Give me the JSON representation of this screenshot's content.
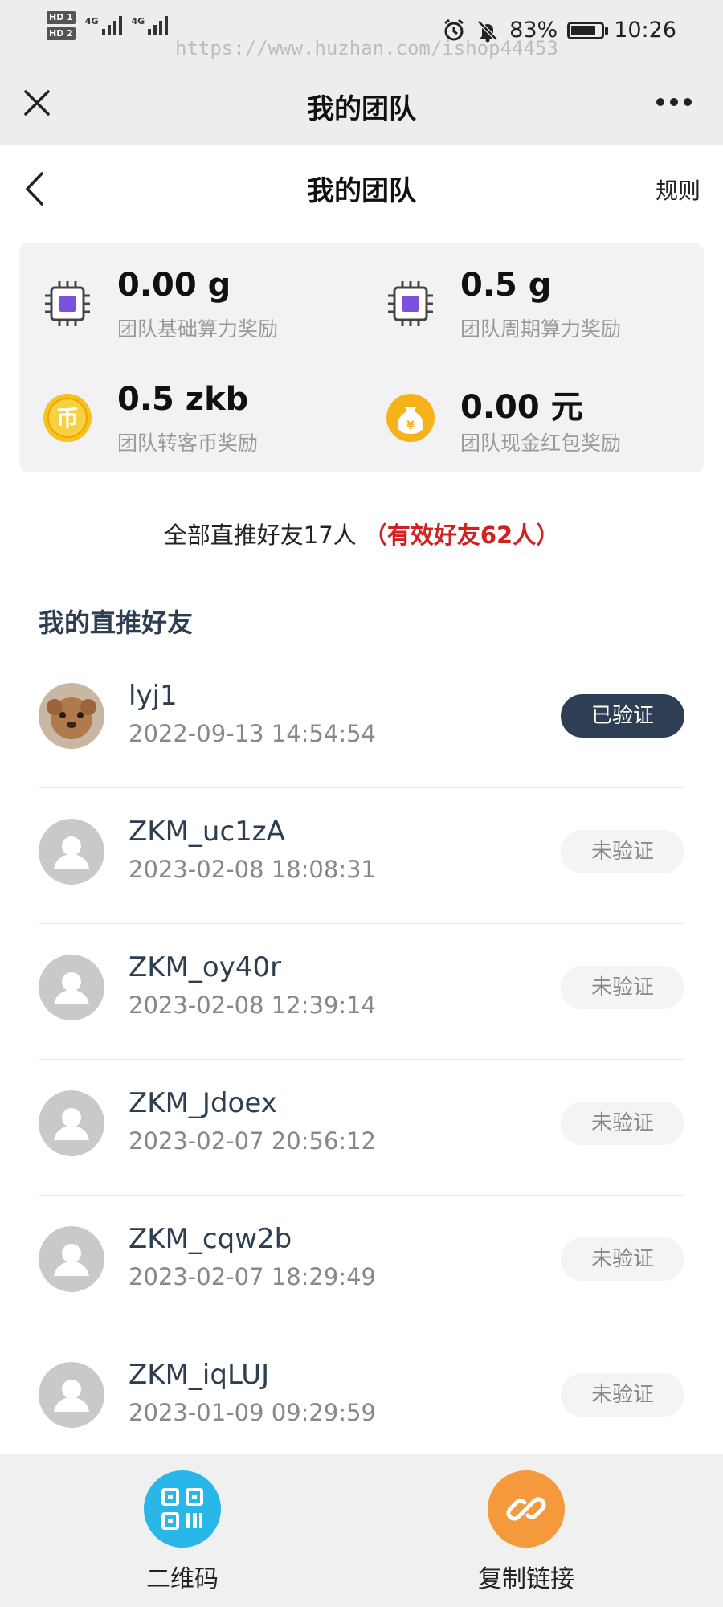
{
  "status_bar": {
    "hd1": "HD 1",
    "hd2": "HD 2",
    "net1": "4G",
    "net2": "4G",
    "battery": "83%",
    "battery_level": 0.83,
    "time": "10:26"
  },
  "watermark": "https://www.huzhan.com/ishop44453",
  "wechat_bar": {
    "title": "我的团队"
  },
  "header": {
    "title": "我的团队",
    "rules_label": "规则"
  },
  "rewards": [
    {
      "value": "0.00 g",
      "label": "团队基础算力奖励",
      "icon": "chip-icon"
    },
    {
      "value": "0.5 g",
      "label": "团队周期算力奖励",
      "icon": "chip-icon"
    },
    {
      "value": "0.5 zkb",
      "label": "团队转客币奖励",
      "icon": "coin-icon"
    },
    {
      "value": "0.00 元",
      "label": "团队现金红包奖励",
      "icon": "money-bag-icon"
    }
  ],
  "summary": {
    "text": "全部直推好友17人",
    "highlight": "（有效好友62人）"
  },
  "friends": {
    "heading": "我的直推好友",
    "items": [
      {
        "name": "lyj1",
        "time": "2022-09-13 14:54:54",
        "status": "已验证",
        "verified": true
      },
      {
        "name": "ZKM_uc1zA",
        "time": "2023-02-08 18:08:31",
        "status": "未验证",
        "verified": false
      },
      {
        "name": "ZKM_oy40r",
        "time": "2023-02-08 12:39:14",
        "status": "未验证",
        "verified": false
      },
      {
        "name": "ZKM_Jdoex",
        "time": "2023-02-07 20:56:12",
        "status": "未验证",
        "verified": false
      },
      {
        "name": "ZKM_cqw2b",
        "time": "2023-02-07 18:29:49",
        "status": "未验证",
        "verified": false
      },
      {
        "name": "ZKM_iqLUJ",
        "time": "2023-01-09 09:29:59",
        "status": "未验证",
        "verified": false
      }
    ]
  },
  "bottom_bar": {
    "qrcode_label": "二维码",
    "copy_link_label": "复制链接"
  },
  "colors": {
    "verified_badge": "#2d3e55",
    "highlight_red": "#d32020",
    "qr_button": "#29b6e8",
    "link_button": "#f59a3c",
    "chip_purple": "#7b4fe0",
    "coin_yellow": "#f7c21a"
  }
}
